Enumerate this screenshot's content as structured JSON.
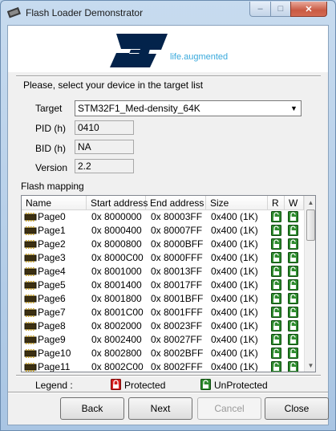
{
  "window": {
    "title": "Flash Loader Demonstrator"
  },
  "logo": {
    "tagline": "life.augmented",
    "brand_color": "#03234b",
    "accent_color": "#39a9dc"
  },
  "prompt": "Please, select your device in the target list",
  "target": {
    "label": "Target",
    "value": "STM32F1_Med-density_64K"
  },
  "pid": {
    "label": "PID  (h)",
    "value": "0410"
  },
  "bid": {
    "label": "BID  (h)",
    "value": "NA"
  },
  "version": {
    "label": "Version",
    "value": "2.2"
  },
  "flash_mapping": {
    "label": "Flash mapping",
    "columns": [
      "Name",
      "Start address",
      "End address",
      "Size",
      "R",
      "W"
    ],
    "rows": [
      {
        "name": "Page0",
        "start": "0x 8000000",
        "end": "0x 80003FF",
        "size": "0x400 (1K)"
      },
      {
        "name": "Page1",
        "start": "0x 8000400",
        "end": "0x 80007FF",
        "size": "0x400 (1K)"
      },
      {
        "name": "Page2",
        "start": "0x 8000800",
        "end": "0x 8000BFF",
        "size": "0x400 (1K)"
      },
      {
        "name": "Page3",
        "start": "0x 8000C00",
        "end": "0x 8000FFF",
        "size": "0x400 (1K)"
      },
      {
        "name": "Page4",
        "start": "0x 8001000",
        "end": "0x 80013FF",
        "size": "0x400 (1K)"
      },
      {
        "name": "Page5",
        "start": "0x 8001400",
        "end": "0x 80017FF",
        "size": "0x400 (1K)"
      },
      {
        "name": "Page6",
        "start": "0x 8001800",
        "end": "0x 8001BFF",
        "size": "0x400 (1K)"
      },
      {
        "name": "Page7",
        "start": "0x 8001C00",
        "end": "0x 8001FFF",
        "size": "0x400 (1K)"
      },
      {
        "name": "Page8",
        "start": "0x 8002000",
        "end": "0x 80023FF",
        "size": "0x400 (1K)"
      },
      {
        "name": "Page9",
        "start": "0x 8002400",
        "end": "0x 80027FF",
        "size": "0x400 (1K)"
      },
      {
        "name": "Page10",
        "start": "0x 8002800",
        "end": "0x 8002BFF",
        "size": "0x400 (1K)"
      },
      {
        "name": "Page11",
        "start": "0x 8002C00",
        "end": "0x 8002FFF",
        "size": "0x400 (1K)"
      }
    ],
    "r_state": "unprotected-icon",
    "w_state": "unprotected-icon"
  },
  "legend": {
    "label": "Legend :",
    "protected": "Protected",
    "unprotected": "UnProtected",
    "protected_color": "#d42020",
    "unprotected_color": "#2e8b2e"
  },
  "buttons": {
    "back": "Back",
    "next": "Next",
    "cancel": "Cancel",
    "close": "Close"
  }
}
